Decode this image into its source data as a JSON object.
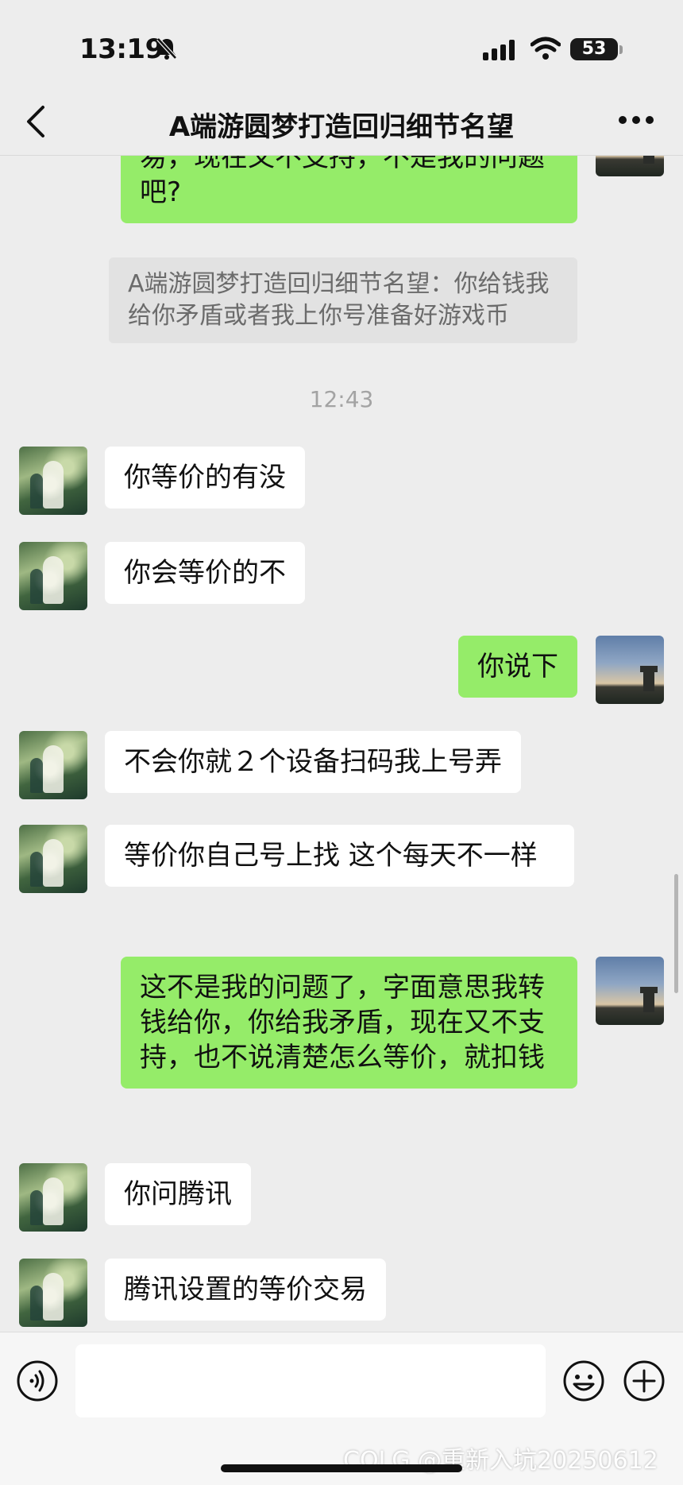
{
  "status_bar": {
    "time": "13:19",
    "battery": "53"
  },
  "nav": {
    "title": "A端游圆梦打造回归细节名望"
  },
  "messages": [
    {
      "type": "out",
      "text": "易，现在又不支持，不是我的问题吧?"
    },
    {
      "type": "quote",
      "text": "A端游圆梦打造回归细节名望：你给钱我给你矛盾或者我上你号准备好游戏币"
    },
    {
      "type": "timestamp",
      "text": "12:43"
    },
    {
      "type": "in",
      "text": "你等价的有没"
    },
    {
      "type": "in",
      "text": "你会等价的不"
    },
    {
      "type": "out",
      "text": "你说下"
    },
    {
      "type": "in",
      "text": "不会你就２个设备扫码我上号弄"
    },
    {
      "type": "in",
      "text": "等价你自己号上找  这个每天不一样"
    },
    {
      "type": "out",
      "text": "这不是我的问题了，字面意思我转钱给你，你给我矛盾，现在又不支持，也不说清楚怎么等价，就扣钱"
    },
    {
      "type": "in",
      "text": "你问腾讯"
    },
    {
      "type": "in",
      "text": "腾讯设置的等价交易"
    }
  ],
  "input": {
    "value": "",
    "placeholder": ""
  },
  "watermark": "COLG @重新入坑20250612",
  "icons": {
    "back": "chevron-left-icon",
    "more": "more-dots-icon",
    "voice": "voice-icon",
    "emoji": "emoji-icon",
    "plus": "plus-icon",
    "mute": "bell-slash-icon",
    "signal": "cellular-signal-icon",
    "wifi": "wifi-icon"
  },
  "colors": {
    "background": "#ededed",
    "outgoing_bubble": "#95ec69",
    "incoming_bubble": "#ffffff",
    "quote_bubble": "#e2e2e2"
  }
}
